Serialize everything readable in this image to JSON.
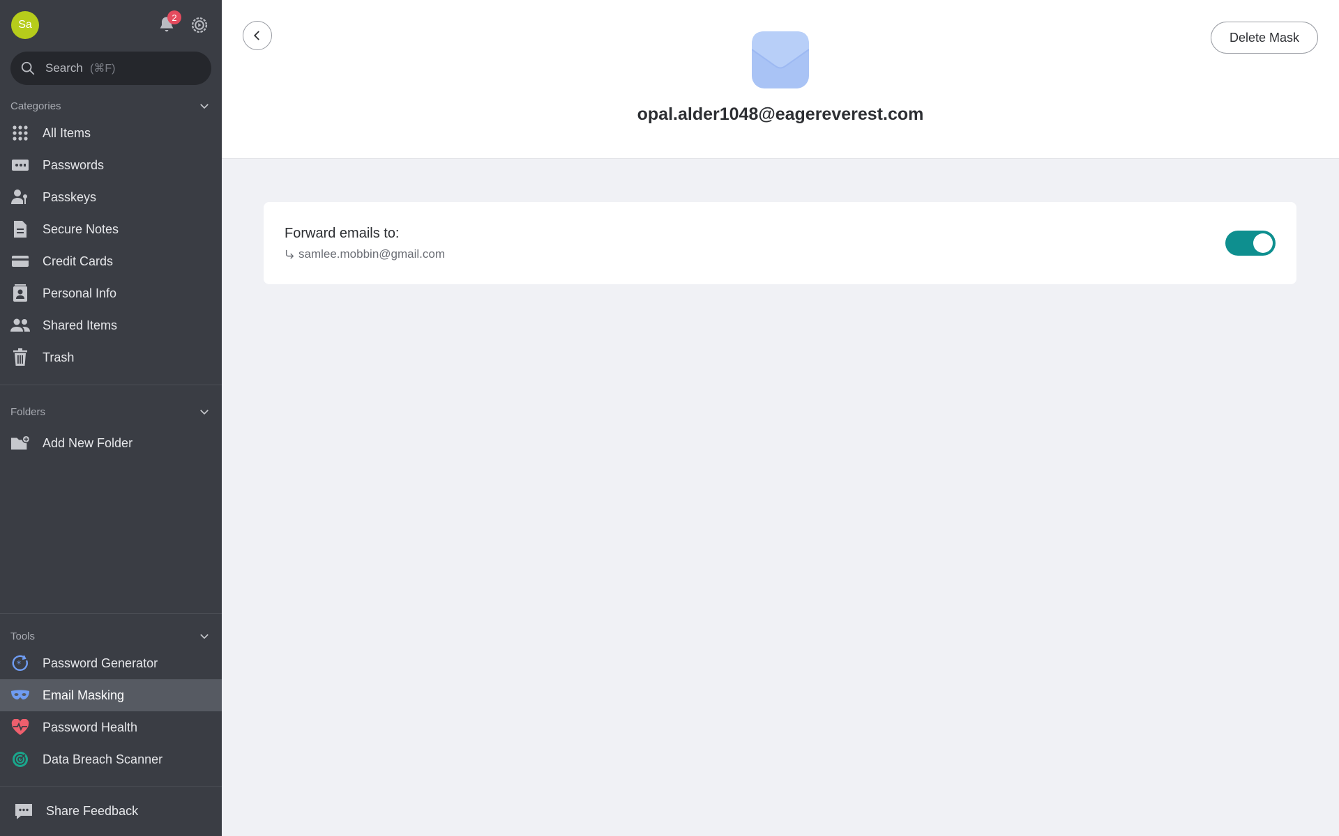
{
  "sidebar": {
    "avatar_initials": "Sa",
    "notifications_count": "2",
    "search": {
      "placeholder": "Search",
      "shortcut": "(⌘F)"
    },
    "categories": {
      "title": "Categories",
      "items": [
        {
          "label": "All Items",
          "icon": "grid-icon"
        },
        {
          "label": "Passwords",
          "icon": "password-card-icon"
        },
        {
          "label": "Passkeys",
          "icon": "passkey-person-icon"
        },
        {
          "label": "Secure Notes",
          "icon": "note-icon"
        },
        {
          "label": "Credit Cards",
          "icon": "credit-card-icon"
        },
        {
          "label": "Personal Info",
          "icon": "contact-icon"
        },
        {
          "label": "Shared Items",
          "icon": "people-icon"
        },
        {
          "label": "Trash",
          "icon": "trash-icon"
        }
      ]
    },
    "folders": {
      "title": "Folders",
      "add_label": "Add New Folder"
    },
    "tools": {
      "title": "Tools",
      "items": [
        {
          "label": "Password Generator",
          "icon": "generator-icon"
        },
        {
          "label": "Email Masking",
          "icon": "mask-icon",
          "active": true
        },
        {
          "label": "Password Health",
          "icon": "heart-pulse-icon"
        },
        {
          "label": "Data Breach Scanner",
          "icon": "scanner-icon"
        }
      ]
    },
    "feedback_label": "Share Feedback"
  },
  "main": {
    "mask_address": "opal.alder1048@eagereverest.com",
    "delete_label": "Delete Mask",
    "forward": {
      "label": "Forward emails to:",
      "target": "samlee.mobbin@gmail.com",
      "enabled": true
    }
  },
  "colors": {
    "sidebar_bg": "#3a3d44",
    "accent_toggle": "#0e8f8f",
    "avatar": "#b6cc1b",
    "badge": "#e54b5e",
    "mail_icon": "#a9c3f5"
  }
}
